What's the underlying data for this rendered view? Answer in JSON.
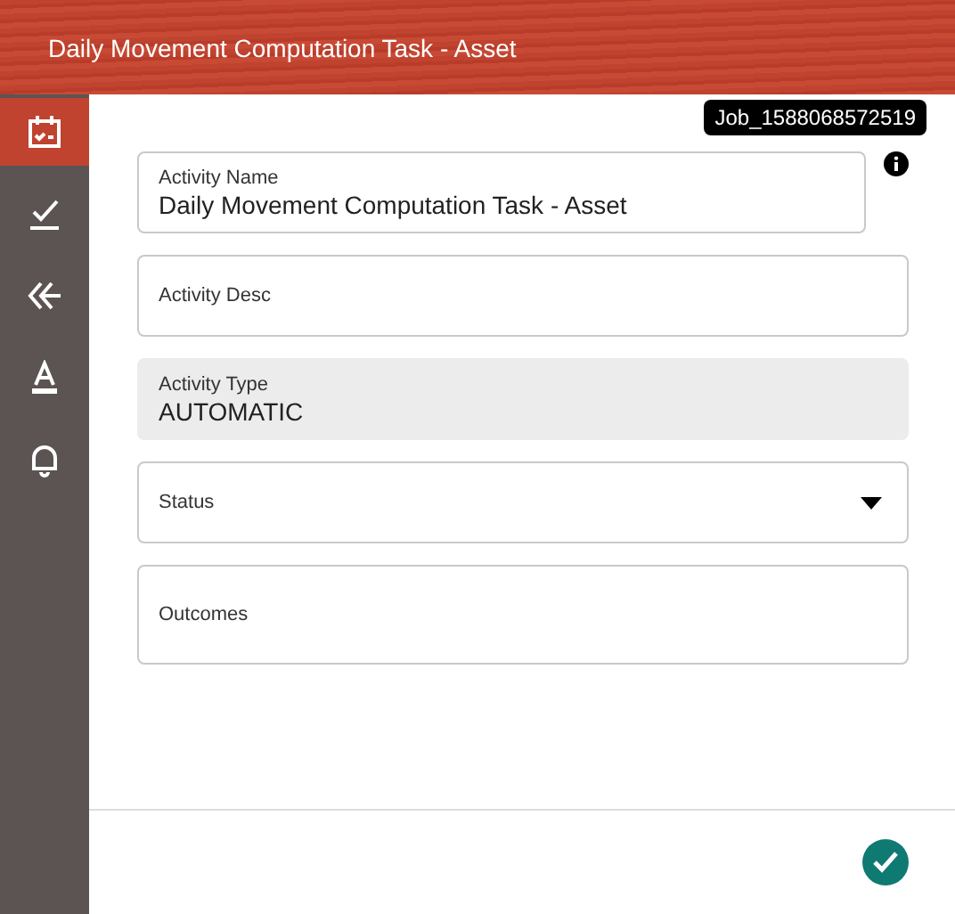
{
  "header": {
    "title": "Daily Movement Computation Task - Asset"
  },
  "sidebar": {
    "items": [
      {
        "kind": "calendar",
        "selected": true
      },
      {
        "kind": "check",
        "selected": false
      },
      {
        "kind": "back",
        "selected": false
      },
      {
        "kind": "text",
        "selected": false
      },
      {
        "kind": "bell",
        "selected": false
      }
    ]
  },
  "tooltip": {
    "text": "Job_1588068572519"
  },
  "fields": [
    {
      "kind": "text",
      "label": "Activity Name",
      "value": "Daily Movement Computation Task - Asset",
      "info": true
    },
    {
      "kind": "text",
      "label": "Activity Desc"
    },
    {
      "kind": "readonly",
      "label": "Activity Type",
      "value": "AUTOMATIC"
    },
    {
      "kind": "select",
      "label": "Status"
    },
    {
      "kind": "textarea",
      "label": "Outcomes"
    }
  ]
}
